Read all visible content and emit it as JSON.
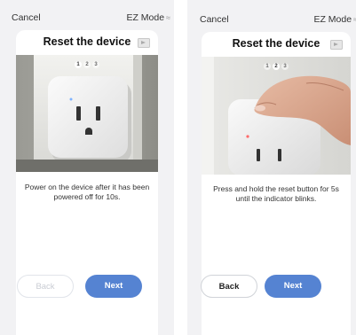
{
  "left_screen": {
    "cancel_label": "Cancel",
    "mode_label": "EZ Mode",
    "mode_icon": "wifi-icon",
    "title": "Reset the device",
    "video_icon": "video-icon",
    "steps": [
      "1",
      "2",
      "3"
    ],
    "active_step": 1,
    "description": "Power on the device after it has been powered off for 10s.",
    "back_label": "Back",
    "next_label": "Next",
    "back_enabled": false
  },
  "right_screen": {
    "cancel_label": "Cancel",
    "mode_label": "EZ Mode",
    "mode_icon": "wifi-icon",
    "title": "Reset the device",
    "video_icon": "video-icon",
    "steps": [
      "1",
      "2",
      "3"
    ],
    "active_step": 2,
    "description": "Press and hold the reset button for 5s until the indicator blinks.",
    "back_label": "Back",
    "next_label": "Next",
    "back_enabled": true
  },
  "colors": {
    "accent": "#5583d2",
    "background": "#f2f2f4",
    "card": "#ffffff"
  }
}
